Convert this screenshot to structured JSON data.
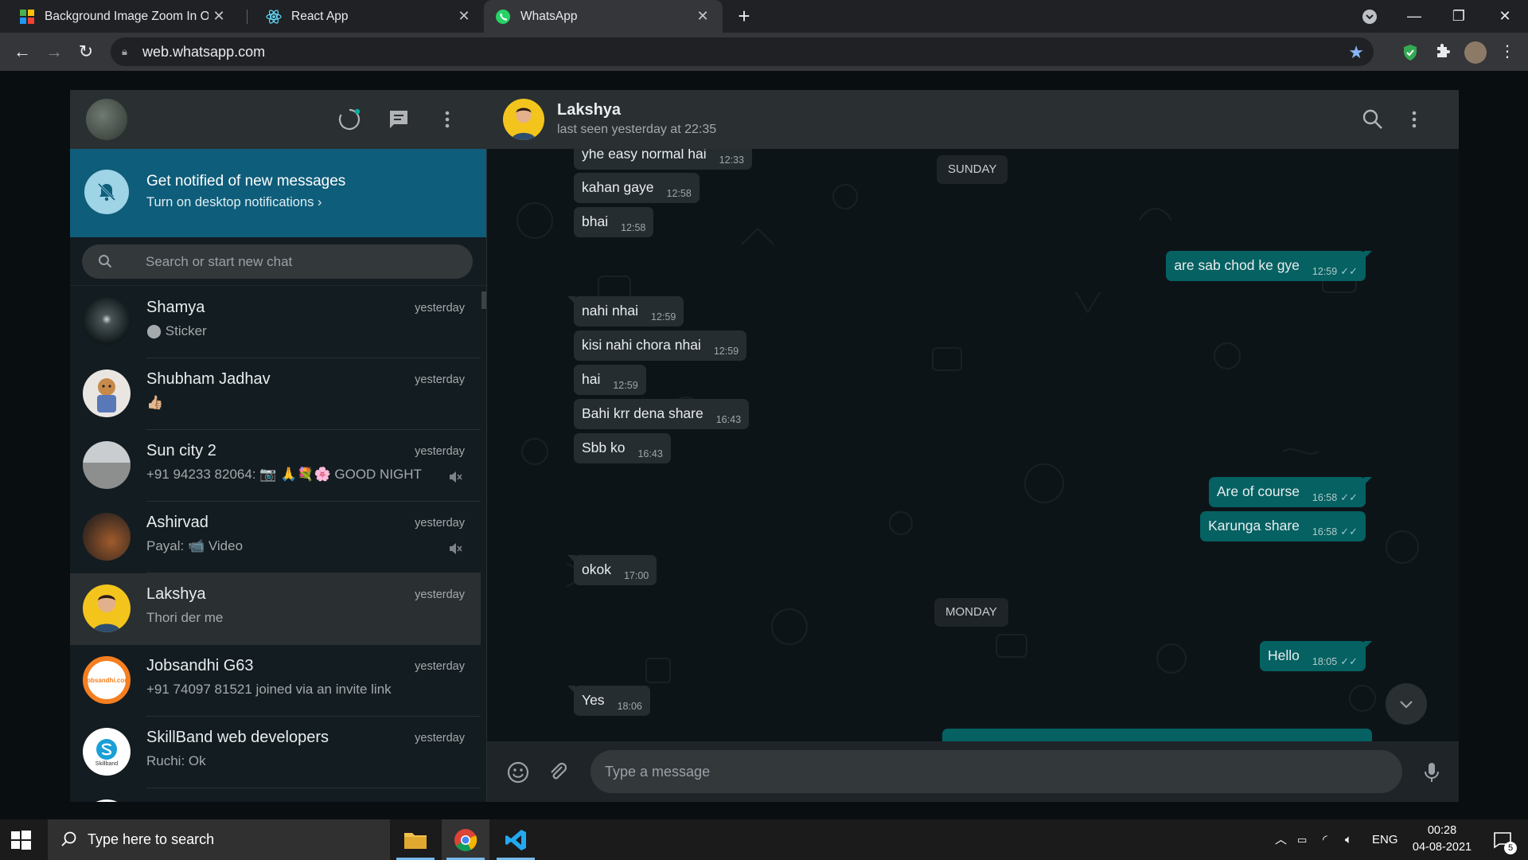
{
  "browser": {
    "tabs": [
      {
        "title": "Background Image Zoom In On H",
        "active": false
      },
      {
        "title": "React App",
        "active": false
      },
      {
        "title": "WhatsApp",
        "active": true
      }
    ],
    "new_tab_label": "+",
    "url": "web.whatsapp.com"
  },
  "sidebar": {
    "notification": {
      "title": "Get notified of new messages",
      "subtitle": "Turn on desktop notifications ›"
    },
    "search_placeholder": "Search or start new chat",
    "chats": [
      {
        "name": "Shamya",
        "time": "yesterday",
        "preview_icon": "sticker-icon",
        "preview": "Sticker",
        "muted": false,
        "selected": false
      },
      {
        "name": "Shubham Jadhav",
        "time": "yesterday",
        "preview": "👍🏼",
        "muted": false,
        "selected": false
      },
      {
        "name": "Sun city 2",
        "time": "yesterday",
        "preview": "+91 94233 82064: 📷 🙏💐🌸 GOOD NIGHT ...",
        "muted": true,
        "selected": false
      },
      {
        "name": "Ashirvad",
        "time": "yesterday",
        "preview": "Payal: 📹 Video",
        "muted": true,
        "selected": false
      },
      {
        "name": "Lakshya",
        "time": "yesterday",
        "preview": "Thori der me",
        "muted": false,
        "selected": true
      },
      {
        "name": "Jobsandhi G63",
        "time": "yesterday",
        "preview": "+91 74097 81521 joined via an invite link",
        "muted": false,
        "selected": false
      },
      {
        "name": "SkillBand web developers",
        "time": "yesterday",
        "preview": "Ruchi: Ok",
        "muted": false,
        "selected": false
      }
    ],
    "avatar_texts": {
      "jobsandhi": "Jobsandhi.com",
      "skillband": "Skillband"
    }
  },
  "conversation": {
    "contact_name": "Lakshya",
    "last_seen": "last seen yesterday at 22:35",
    "day_labels": {
      "sunday": "SUNDAY",
      "monday": "MONDAY"
    },
    "messages": [
      {
        "dir": "in",
        "text": "yhe easy normal hai",
        "time": "12:33"
      },
      {
        "dir": "in",
        "text": "kahan gaye",
        "time": "12:58"
      },
      {
        "dir": "in",
        "text": "bhai",
        "time": "12:58"
      },
      {
        "dir": "out",
        "text": "are sab chod ke gye",
        "time": "12:59",
        "tick": "✓✓"
      },
      {
        "dir": "in",
        "text": "nahi nhai",
        "time": "12:59"
      },
      {
        "dir": "in",
        "text": "kisi nahi chora nhai",
        "time": "12:59"
      },
      {
        "dir": "in",
        "text": "hai",
        "time": "12:59"
      },
      {
        "dir": "in",
        "text": "Bahi krr dena share",
        "time": "16:43"
      },
      {
        "dir": "in",
        "text": "Sbb ko",
        "time": "16:43"
      },
      {
        "dir": "out",
        "text": "Are of course",
        "time": "16:58",
        "tick": "✓✓"
      },
      {
        "dir": "out",
        "text": "Karunga share",
        "time": "16:58",
        "tick": "✓✓"
      },
      {
        "dir": "in",
        "text": "okok",
        "time": "17:00"
      },
      {
        "dir": "out",
        "text": "Hello",
        "time": "18:05",
        "tick": "✓✓"
      },
      {
        "dir": "in",
        "text": "Yes",
        "time": "18:06"
      }
    ],
    "composer_placeholder": "Type a message"
  },
  "taskbar": {
    "search_placeholder": "Type here to search",
    "language": "ENG",
    "time": "00:28",
    "date": "04-08-2021",
    "notification_count": "5"
  },
  "colors": {
    "accent_teal": "#056162",
    "notification_banner": "#0e5d7a",
    "incoming_bubble": "#262d31",
    "panel_header": "#2a2f32"
  }
}
